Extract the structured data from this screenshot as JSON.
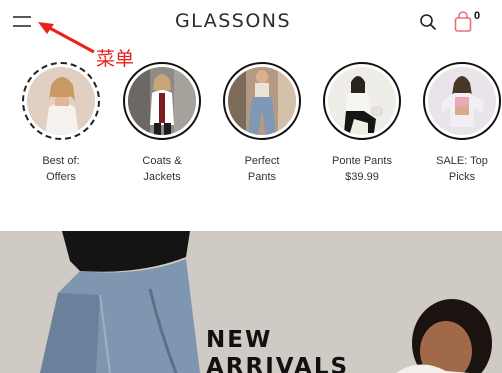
{
  "header": {
    "logo": "GLASSONS",
    "bag_count": "0"
  },
  "annotation": {
    "label": "菜单",
    "color": "#e8221a"
  },
  "stories": [
    {
      "line1": "Best of:",
      "line2": "Offers"
    },
    {
      "line1": "Coats &",
      "line2": "Jackets"
    },
    {
      "line1": "Perfect",
      "line2": "Pants"
    },
    {
      "line1": "Ponte Pants",
      "line2": "$39.99"
    },
    {
      "line1": "SALE: Top",
      "line2": "Picks"
    }
  ],
  "hero": {
    "title_line1": "NEW",
    "title_line2": "ARRIVALS"
  },
  "icons": [
    "menu-icon",
    "search-icon",
    "shopping-bag-icon"
  ],
  "colors": {
    "bag_accent": "#e8707a",
    "hero_bg": "#cfcac3"
  }
}
